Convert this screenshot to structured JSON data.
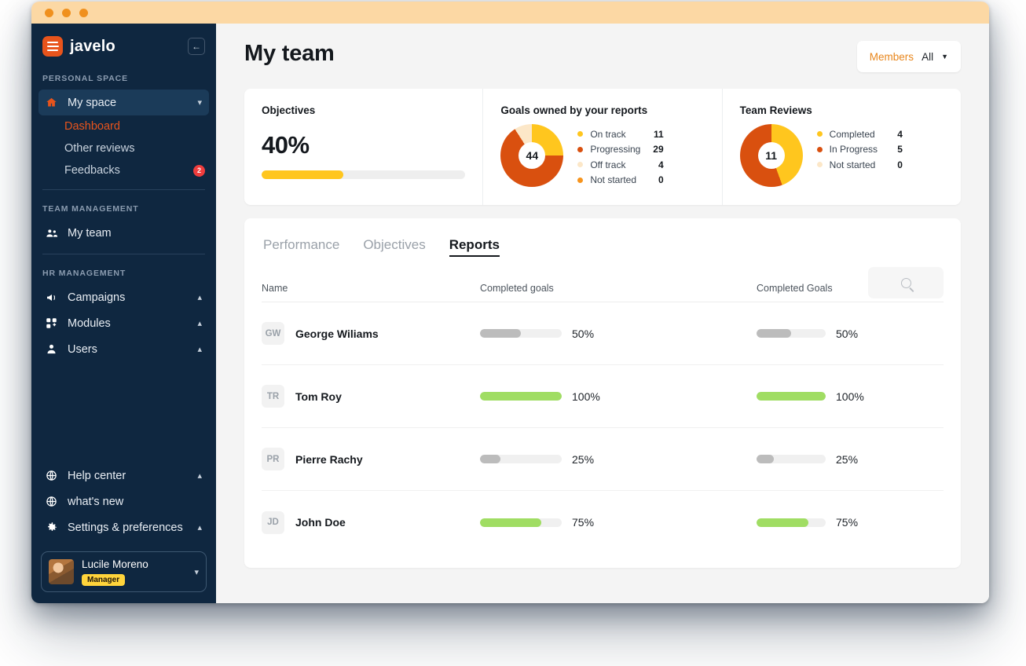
{
  "window": {
    "dots": 3
  },
  "sidebar": {
    "brand": "javelo",
    "collapse_icon": "chevron-left-icon",
    "sections": [
      {
        "label": "PERSONAL SPACE",
        "items": [
          {
            "label": "My space",
            "icon": "home-icon",
            "active": true,
            "chevron": "chevron-down-icon"
          }
        ],
        "subitems": [
          {
            "label": "Dashboard",
            "current": true
          },
          {
            "label": "Other reviews",
            "current": false
          },
          {
            "label": "Feedbacks",
            "current": false,
            "badge": "2"
          }
        ]
      },
      {
        "label": "TEAM MANAGEMENT",
        "items": [
          {
            "label": "My team",
            "icon": "people-icon",
            "active": false
          }
        ]
      },
      {
        "label": "HR MANAGEMENT",
        "items": [
          {
            "label": "Campaigns",
            "icon": "megaphone-icon",
            "chevron": "chevron-up-icon"
          },
          {
            "label": "Modules",
            "icon": "grid-plus-icon",
            "chevron": "chevron-up-icon"
          },
          {
            "label": "Users",
            "icon": "user-icon",
            "chevron": "chevron-up-icon"
          }
        ]
      }
    ],
    "bottom_items": [
      {
        "label": "Help center",
        "icon": "globe-icon",
        "chevron": "chevron-up-icon"
      },
      {
        "label": "what's new",
        "icon": "globe-icon",
        "chevron": ""
      },
      {
        "label": "Settings & preferences",
        "icon": "gear-icon",
        "chevron": "chevron-up-icon"
      }
    ],
    "profile": {
      "name": "Lucile Moreno",
      "role": "Manager",
      "chevron": "chevron-down-icon"
    }
  },
  "header": {
    "title": "My team",
    "members_filter": {
      "label": "Members",
      "value": "All",
      "caret": "caret-down-icon"
    }
  },
  "chart_data": [
    {
      "type": "bar",
      "title": "Objectives",
      "value_label": "40%",
      "values": [
        40
      ],
      "categories": [
        "Objectives"
      ],
      "ylim": [
        0,
        100
      ],
      "color": "#ffc61e"
    },
    {
      "type": "pie",
      "title": "Goals owned by your reports",
      "center_label": "44",
      "categories": [
        "On track",
        "Progressing",
        "Off track",
        "Not started"
      ],
      "values": [
        11,
        29,
        4,
        0
      ],
      "colors": [
        "#ffc61e",
        "#d9500f",
        "#fce7c8",
        "#f7941d"
      ],
      "legend": "right"
    },
    {
      "type": "pie",
      "title": "Team Reviews",
      "center_label": "11",
      "categories": [
        "Completed",
        "In Progress",
        "Not started"
      ],
      "values": [
        4,
        5,
        0
      ],
      "colors": [
        "#ffc61e",
        "#d9500f",
        "#fce7c8"
      ],
      "legend": "right"
    }
  ],
  "cards": {
    "objectives": {
      "title": "Objectives",
      "percent": "40%",
      "fill": 40
    },
    "goals": {
      "title": "Goals owned by your reports",
      "center": "44",
      "legend": [
        {
          "name": "On track",
          "value": "11",
          "color": "#ffc61e"
        },
        {
          "name": "Progressing",
          "value": "29",
          "color": "#d9500f"
        },
        {
          "name": "Off track",
          "value": "4",
          "color": "#fce7c8"
        },
        {
          "name": "Not started",
          "value": "0",
          "color": "#f7941d"
        }
      ]
    },
    "reviews": {
      "title": "Team Reviews",
      "center": "11",
      "legend": [
        {
          "name": "Completed",
          "value": "4",
          "color": "#ffc61e"
        },
        {
          "name": "In Progress",
          "value": "5",
          "color": "#d9500f"
        },
        {
          "name": "Not started",
          "value": "0",
          "color": "#fce7c8"
        }
      ]
    }
  },
  "panel": {
    "tabs": [
      {
        "label": "Performance",
        "active": false
      },
      {
        "label": "Objectives",
        "active": false
      },
      {
        "label": "Reports",
        "active": true
      }
    ],
    "search": {
      "icon": "search-icon",
      "placeholder": ""
    },
    "columns": [
      "Name",
      "Completed goals",
      "Completed Goals"
    ],
    "rows": [
      {
        "initials": "GW",
        "name": "George Wiliams",
        "goals_pct": "50%",
        "goals_val": 50,
        "goals2_pct": "50%",
        "goals2_val": 50,
        "color": "#bcbcbc"
      },
      {
        "initials": "TR",
        "name": "Tom Roy",
        "goals_pct": "100%",
        "goals_val": 100,
        "goals2_pct": "100%",
        "goals2_val": 100,
        "color": "#a0dd63"
      },
      {
        "initials": "PR",
        "name": "Pierre Rachy",
        "goals_pct": "25%",
        "goals_val": 25,
        "goals2_pct": "25%",
        "goals2_val": 25,
        "color": "#bcbcbc"
      },
      {
        "initials": "JD",
        "name": "John Doe",
        "goals_pct": "75%",
        "goals_val": 75,
        "goals2_pct": "75%",
        "goals2_val": 75,
        "color": "#a0dd63"
      }
    ]
  }
}
